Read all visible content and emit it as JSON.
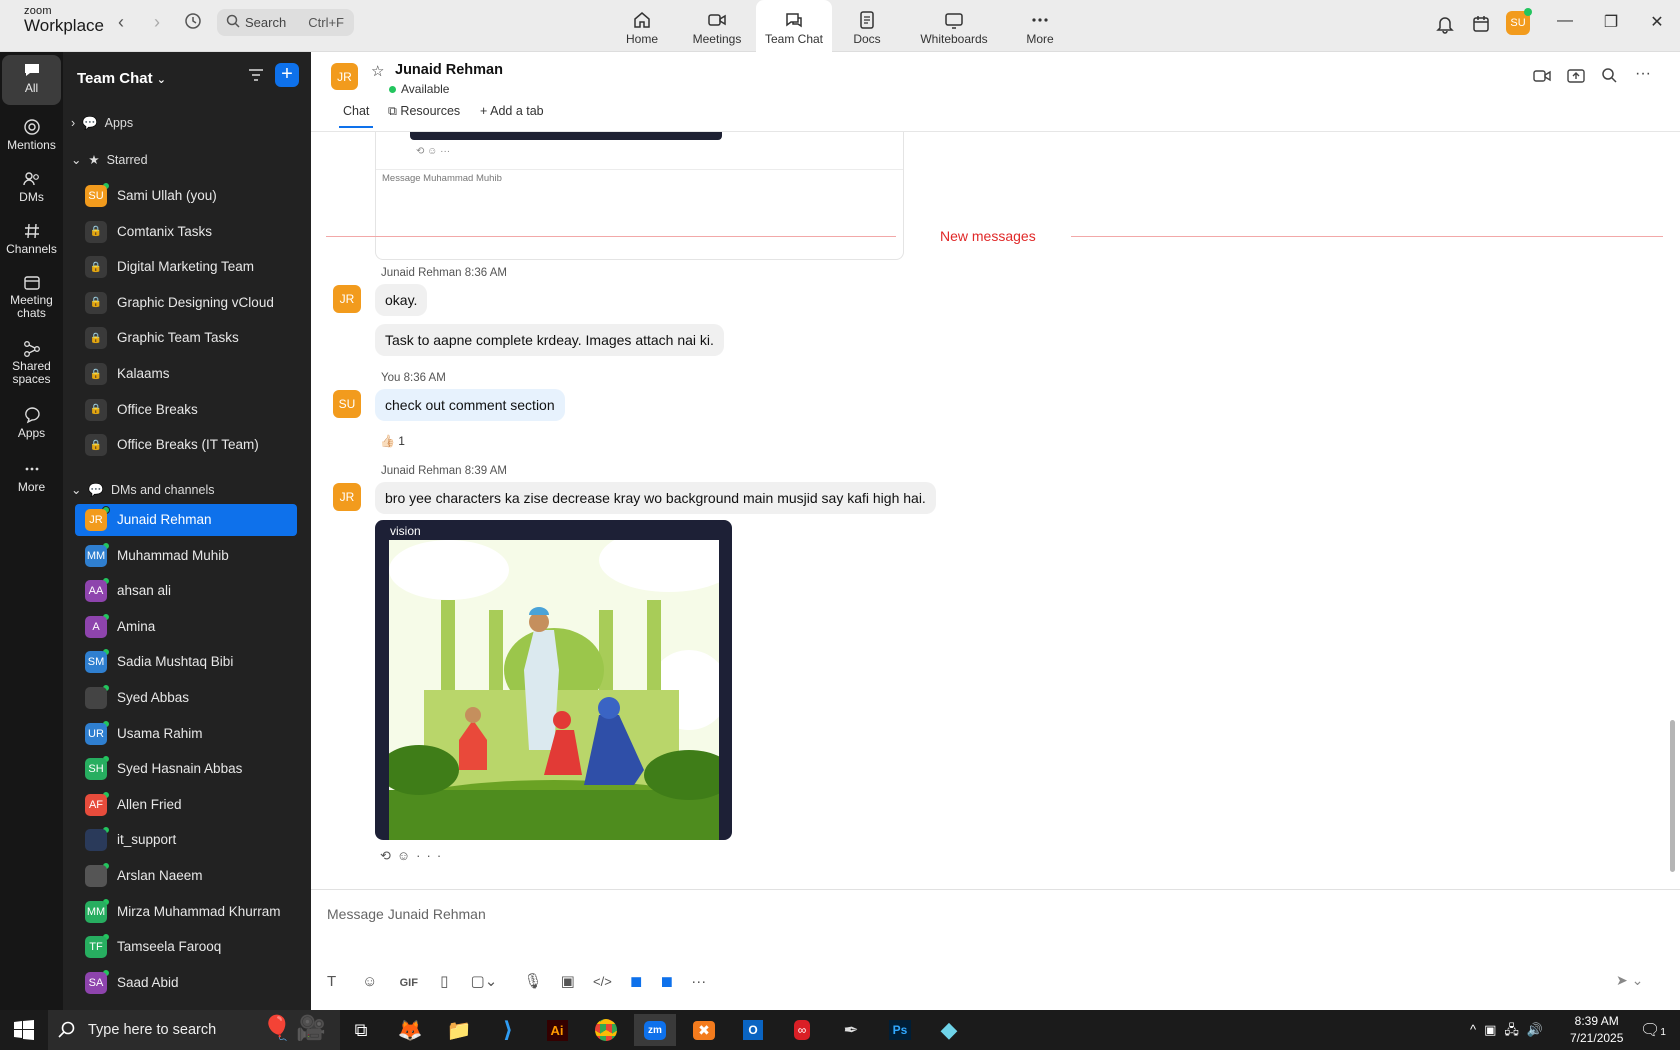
{
  "topbar": {
    "logo_line1": "zoom",
    "logo_line2": "Workplace",
    "search_label": "Search",
    "search_shortcut": "Ctrl+F",
    "tabs": [
      {
        "label": "Home",
        "icon": "home-icon"
      },
      {
        "label": "Meetings",
        "icon": "video-icon"
      },
      {
        "label": "Team Chat",
        "icon": "chat-icon"
      },
      {
        "label": "Docs",
        "icon": "doc-icon"
      },
      {
        "label": "Whiteboards",
        "icon": "whiteboard-icon"
      },
      {
        "label": "More",
        "icon": "more-icon"
      }
    ],
    "user_initials": "SU"
  },
  "rail": {
    "items": [
      {
        "label": "All"
      },
      {
        "label": "Mentions"
      },
      {
        "label": "DMs"
      },
      {
        "label": "Channels"
      },
      {
        "label": "Meeting chats"
      },
      {
        "label": "Shared spaces"
      },
      {
        "label": "Apps"
      },
      {
        "label": "More"
      }
    ]
  },
  "sidebar": {
    "title": "Team Chat",
    "apps_label": "Apps",
    "starred_label": "Starred",
    "starred": [
      {
        "name": "Sami Ullah (you)",
        "initials": "SU",
        "color": "#f29b1d"
      },
      {
        "name": "Comtanix Tasks"
      },
      {
        "name": "Digital Marketing Team"
      },
      {
        "name": "Graphic Designing vCloud"
      },
      {
        "name": "Graphic Team Tasks"
      },
      {
        "name": "Kalaams"
      },
      {
        "name": "Office Breaks"
      },
      {
        "name": "Office Breaks (IT Team)"
      }
    ],
    "dms_label": "DMs and channels",
    "dms": [
      {
        "name": "Junaid Rehman",
        "initials": "JR",
        "color": "#f29b1d"
      },
      {
        "name": "Muhammad Muhib",
        "initials": "MM",
        "color": "#2f7fd0"
      },
      {
        "name": "ahsan ali",
        "initials": "AA",
        "color": "#8e44ad"
      },
      {
        "name": "Amina",
        "initials": "A",
        "color": "#8e44ad"
      },
      {
        "name": "Sadia Mushtaq Bibi",
        "initials": "SM",
        "color": "#2f7fd0"
      },
      {
        "name": "Syed Abbas",
        "initials": "",
        "color": "#444"
      },
      {
        "name": "Usama Rahim",
        "initials": "UR",
        "color": "#2f7fd0"
      },
      {
        "name": "Syed Hasnain Abbas",
        "initials": "SH",
        "color": "#27ae60"
      },
      {
        "name": "Allen Fried",
        "initials": "AF",
        "color": "#e74c3c"
      },
      {
        "name": "it_support",
        "initials": "",
        "color": "#2a3a5a"
      },
      {
        "name": "Arslan Naeem",
        "initials": "",
        "color": "#555"
      },
      {
        "name": "Mirza Muhammad Khurram",
        "initials": "MM",
        "color": "#27ae60"
      },
      {
        "name": "Tamseela Farooq",
        "initials": "TF",
        "color": "#27ae60"
      },
      {
        "name": "Saad Abid",
        "initials": "SA",
        "color": "#8e44ad"
      }
    ]
  },
  "chat": {
    "contact_name": "Junaid Rehman",
    "contact_initials": "JR",
    "status": "Available",
    "tabs": [
      "Chat",
      "Resources",
      "Add a tab"
    ],
    "preview_placeholder": "Message Muhammad Muhib",
    "new_messages_label": "New messages",
    "messages": [
      {
        "sender": "Junaid Rehman",
        "time": "8:36 AM",
        "texts": [
          "okay.",
          "Task to aapne complete krdeay. Images attach nai ki."
        ]
      },
      {
        "sender": "You",
        "time": "8:36 AM",
        "texts": [
          "check out comment section"
        ],
        "reaction_count": "1"
      },
      {
        "sender": "Junaid Rehman",
        "time": "8:39 AM",
        "texts": [
          "bro yee characters ka zise decrease kray wo background main musjid say kafi high hai."
        ],
        "image_caption": "vision"
      }
    ],
    "composer_placeholder": "Message Junaid Rehman",
    "gif_label": "GIF"
  },
  "taskbar": {
    "search_placeholder": "Type here to search",
    "time": "8:39 AM",
    "date": "7/21/2025",
    "notif_count": "1",
    "apps": [
      "task-view",
      "firefox",
      "file-explorer",
      "vscode",
      "illustrator",
      "chrome",
      "zoom",
      "xampp",
      "outlook",
      "creative-cloud",
      "pen-tool",
      "photoshop",
      "app"
    ]
  }
}
